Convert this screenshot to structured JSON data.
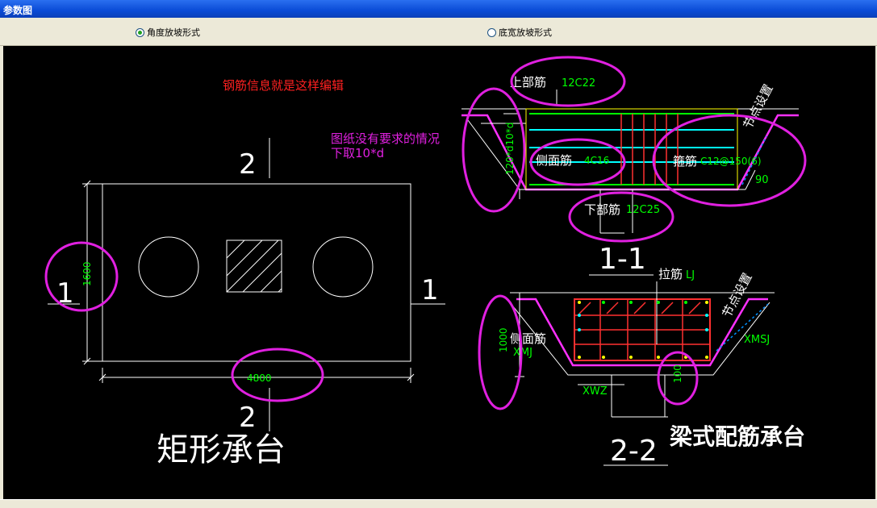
{
  "window": {
    "title": "参数图"
  },
  "options": [
    {
      "label": "角度放坡形式",
      "selected": true
    },
    {
      "label": "底宽放坡形式",
      "selected": false
    }
  ],
  "drawing": {
    "note_red": "钢筋信息就是这样编辑",
    "note_magenta_1": "图纸没有要求的情况",
    "note_magenta_2": "下取10*d",
    "rect": {
      "section_top": "2",
      "section_bottom": "2",
      "section_left": "1",
      "section_right": "1",
      "dim_height": "1600",
      "dim_width": "4800",
      "caption": "矩形承台"
    },
    "section11": {
      "top_bar_label": "上部筋",
      "top_bar_value": "12C22",
      "side_dim": "120*d10*d",
      "side_bar_label": "侧面筋",
      "side_bar_value": "4C16",
      "stirrup_label": "箍筋",
      "stirrup_value": "C12@150(6)",
      "bottom_bar_label": "下部筋",
      "bottom_bar_value": "12C25",
      "angle": "90",
      "node_text": "节点设置",
      "caption": "1-1"
    },
    "section22": {
      "tie_label": "拉筋",
      "tie_value": "LJ",
      "side_label": "侧面筋",
      "side_value": "XMJ",
      "node_text": "节点设置",
      "xmsj": "XMSJ",
      "height_dim": "1000",
      "small_dim": "100",
      "xwz": "XWZ",
      "caption": "2-2",
      "title": "梁式配筋承台"
    }
  }
}
